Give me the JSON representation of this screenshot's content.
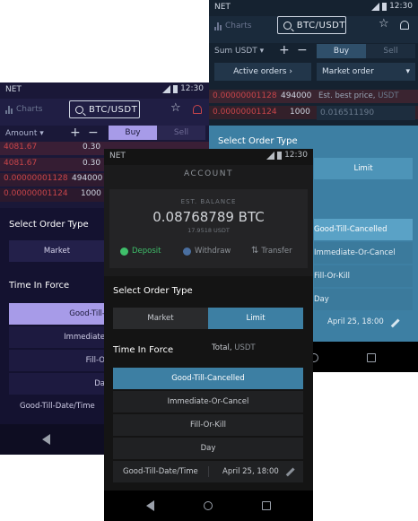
{
  "status_bar": {
    "carrier": "NET",
    "time": "12:30"
  },
  "phone_back": {
    "charts_label": "Charts",
    "pair": "BTC/USDT",
    "amount_label": "Sum USDT",
    "buy_label": "Buy",
    "sell_label": "Sell",
    "active_orders_label": "Active orders",
    "market_order_label": "Market order",
    "order_rows": [
      {
        "price": "0.00000001128",
        "amount": "494000"
      },
      {
        "price": "0.00000001124",
        "amount": "1000"
      }
    ],
    "best_price_label": "Est. best price,",
    "best_price_unit": "USDT",
    "best_price_value": "0.016511190",
    "sheet": {
      "title": "Select Order Type",
      "limit_label": "Limit",
      "tif_selected": "Good-Till-Cancelled",
      "tif_option_2": "Immediate-Or-Cancel",
      "tif_option_3": "Fill-Or-Kill",
      "tif_option_4": "Day",
      "date_value": "April 25, 18:00"
    }
  },
  "phone_mid": {
    "charts_label": "Charts",
    "pair": "BTC/USDT",
    "amount_label": "Amount",
    "buy_label": "Buy",
    "sell_label": "Sell",
    "order_rows": [
      {
        "price": "4081.67",
        "amount": "0.30"
      },
      {
        "price": "4081.67",
        "amount": "0.30"
      },
      {
        "price": "0.00000001128",
        "amount": "494000"
      },
      {
        "price": "0.00000001124",
        "amount": "1000"
      }
    ],
    "sheet": {
      "title": "Select Order Type",
      "market_label": "Market",
      "tif_title": "Time In Force",
      "tif_selected": "Good-Till-",
      "tif_option_2": "Immediate",
      "tif_option_3": "Fill-O",
      "tif_option_4": "Da",
      "date_label": "Good-Till-Date/Time"
    }
  },
  "phone_front": {
    "header": "ACCOUNT",
    "balance_caption": "EST. BALANCE",
    "balance_value": "0.08768789 BTC",
    "balance_fiat": "17.9518 USDT",
    "deposit_label": "Deposit",
    "withdraw_label": "Withdraw",
    "transfer_label": "Transfer",
    "sheet": {
      "title": "Select Order Type",
      "market_label": "Market",
      "limit_label": "Limit",
      "tif_title": "Time In Force",
      "total_label": "Total,",
      "total_unit": "USDT",
      "tif_options": [
        "Good-Till-Cancelled",
        "Immediate-Or-Cancel",
        "Fill-Or-Kill",
        "Day"
      ],
      "date_label": "Good-Till-Date/Time",
      "date_value": "April 25, 18:00"
    }
  },
  "colors": {
    "accent_teal": "#3d7fa3",
    "accent_purple": "#a79be8",
    "sell_red": "#c8454a",
    "buy_green": "#3fbf6a"
  }
}
